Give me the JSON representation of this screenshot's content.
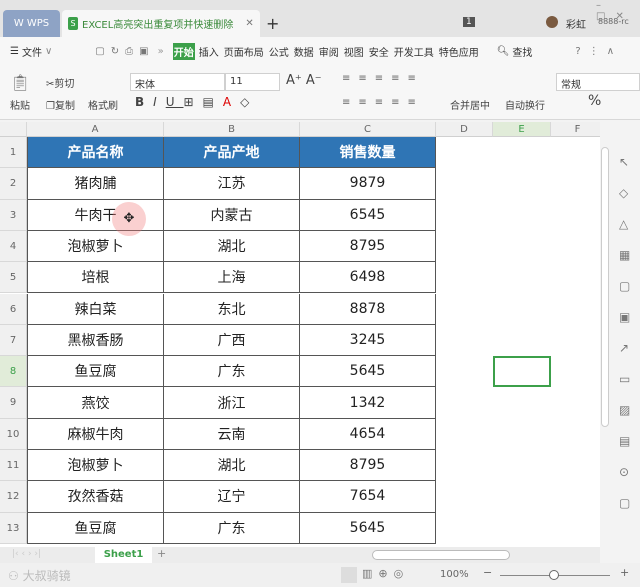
{
  "titlebar": {
    "app": "WPS",
    "doc_title": "EXCEL高亮突出重复项并快速删除",
    "new_tab": "+",
    "badge": "1",
    "user": "彩虹",
    "account": "8888-rc"
  },
  "menu": {
    "file": "文件",
    "more": "»",
    "items": [
      "开始",
      "插入",
      "页面布局",
      "公式",
      "数据",
      "审阅",
      "视图",
      "安全",
      "开发工具",
      "特色应用"
    ],
    "active": 0,
    "search": "查找"
  },
  "ribbon": {
    "paste": "粘贴",
    "cut": "剪切",
    "copy": "复制",
    "format_painter": "格式刷",
    "font": "宋体",
    "size": "11",
    "merge": "合并居中",
    "wrap": "自动换行",
    "number_format": "常规",
    "percent": "%"
  },
  "columns": [
    "A",
    "B",
    "C",
    "D",
    "E",
    "F"
  ],
  "rows": [
    "1",
    "2",
    "3",
    "4",
    "5",
    "6",
    "7",
    "8",
    "9",
    "10",
    "11",
    "12",
    "13"
  ],
  "table": {
    "headers": [
      "产品名称",
      "产品产地",
      "销售数量"
    ],
    "data": [
      [
        "猪肉脯",
        "江苏",
        "9879"
      ],
      [
        "牛肉干",
        "内蒙古",
        "6545"
      ],
      [
        "泡椒萝卜",
        "湖北",
        "8795"
      ],
      [
        "培根",
        "上海",
        "6498"
      ],
      [
        "辣白菜",
        "东北",
        "8878"
      ],
      [
        "黑椒香肠",
        "广西",
        "3245"
      ],
      [
        "鱼豆腐",
        "广东",
        "5645"
      ],
      [
        "燕饺",
        "浙江",
        "1342"
      ],
      [
        "麻椒牛肉",
        "云南",
        "4654"
      ],
      [
        "泡椒萝卜",
        "湖北",
        "8795"
      ],
      [
        "孜然香菇",
        "辽宁",
        "7654"
      ],
      [
        "鱼豆腐",
        "广东",
        "5645"
      ]
    ]
  },
  "selected_cell": "E8",
  "sheet": {
    "name": "Sheet1",
    "add": "+"
  },
  "status": {
    "zoom": "100%",
    "watermark": "大叔骑镜"
  },
  "colors": {
    "header_bg": "#2f75b5",
    "accent": "#3ca04a"
  }
}
